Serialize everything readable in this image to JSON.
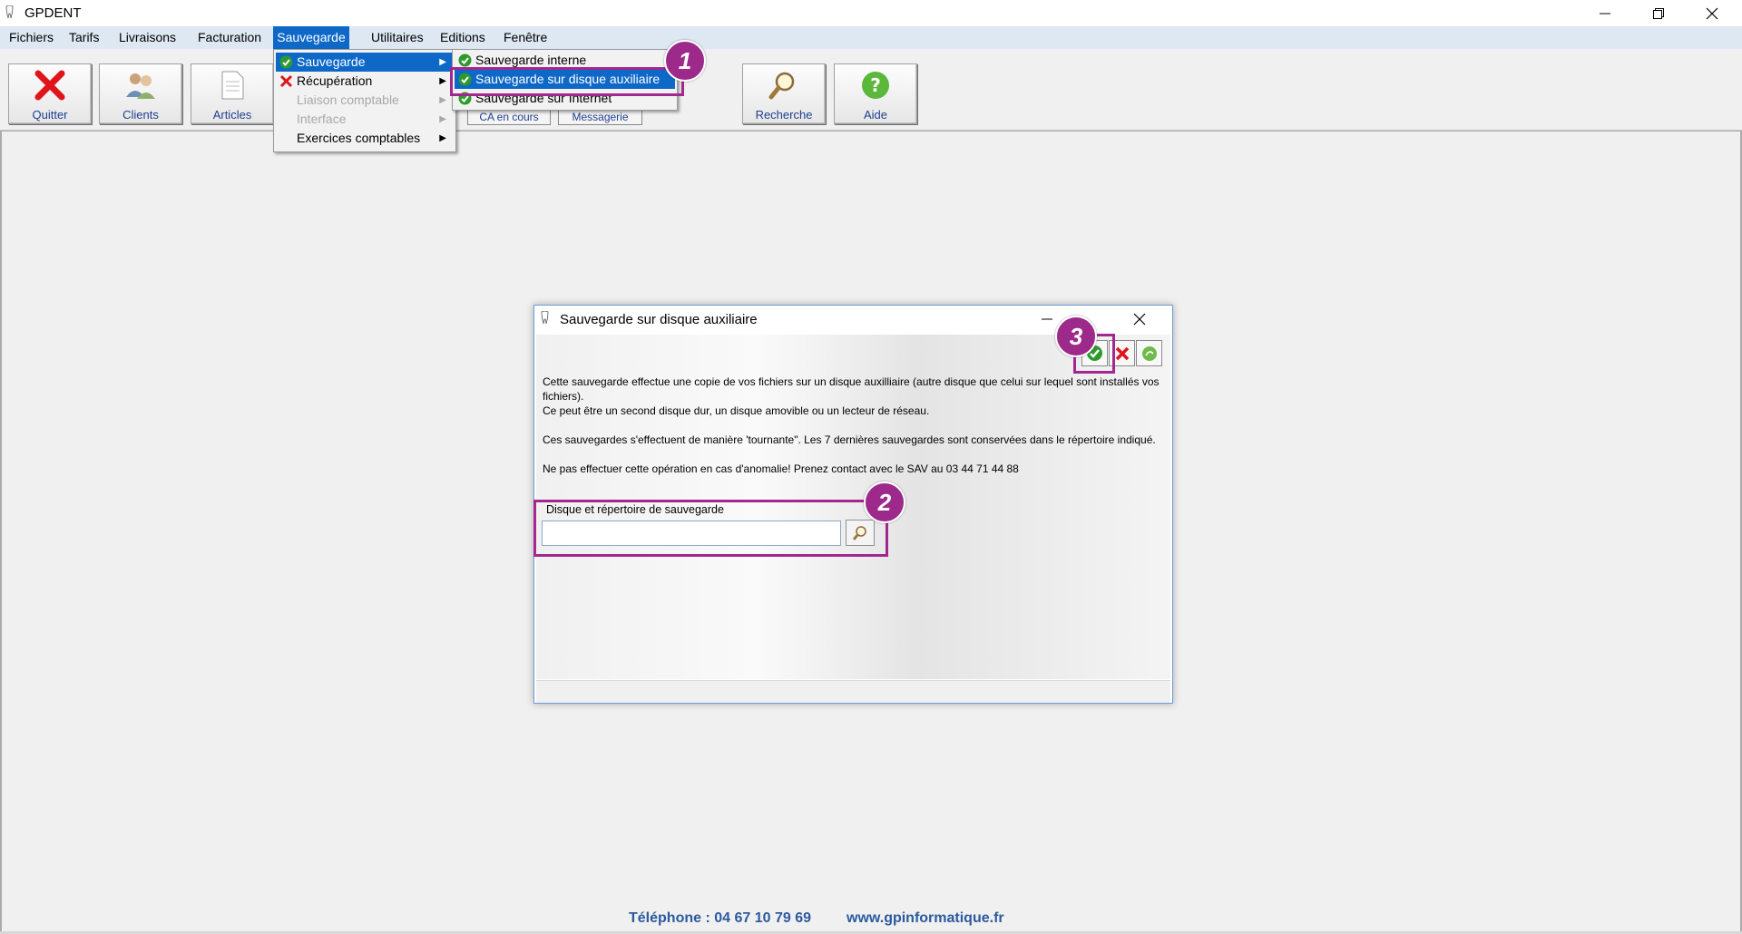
{
  "window": {
    "title": "GPDENT"
  },
  "menubar": {
    "items": [
      "Fichiers",
      "Tarifs",
      "Livraisons",
      "Facturation",
      "Sauvegarde",
      "Utilitaires",
      "Editions",
      "Fenêtre"
    ]
  },
  "toolbar": {
    "buttons": [
      "Quitter",
      "Clients",
      "Articles",
      "Recherche",
      "Aide"
    ],
    "small_buttons": [
      "CA en cours",
      "Messagerie"
    ]
  },
  "menu_sauvegarde": {
    "items": [
      "Sauvegarde",
      "Récupération",
      "Liaison comptable",
      "Interface",
      "Exercices comptables"
    ]
  },
  "submenu_sauvegarde": {
    "items": [
      "Sauvegarde interne",
      "Sauvegarde sur disque auxiliaire",
      "Sauvegarde sur Internet"
    ]
  },
  "dialog": {
    "title": "Sauvegarde sur disque auxiliaire",
    "paragraph1": "Cette sauvegarde effectue une copie de vos fichiers sur un disque auxilliaire (autre disque que celui sur lequel sont installés vos fichiers).",
    "paragraph1b": "Ce peut être un second disque dur, un disque amovible ou un lecteur de réseau.",
    "paragraph2": "Ces sauvegardes s'effectuent de manière 'tournante\". Les 7 dernières sauvegardes sont conservées dans le répertoire indiqué.",
    "paragraph3": "Ne pas effectuer cette opération en cas d'anomalie! Prenez contact avec le SAV au 03 44 71 44 88",
    "field_label": "Disque et répertoire de sauvegarde",
    "field_value": ""
  },
  "footer": {
    "phone": "Téléphone : 04 67 10 79 69",
    "web": "www.gpinformatique.fr"
  },
  "annotations": [
    "1",
    "2",
    "3"
  ],
  "colors": {
    "accent": "#0e68c8",
    "annotation": "#a3278f",
    "menubar": "#dde8f3"
  }
}
